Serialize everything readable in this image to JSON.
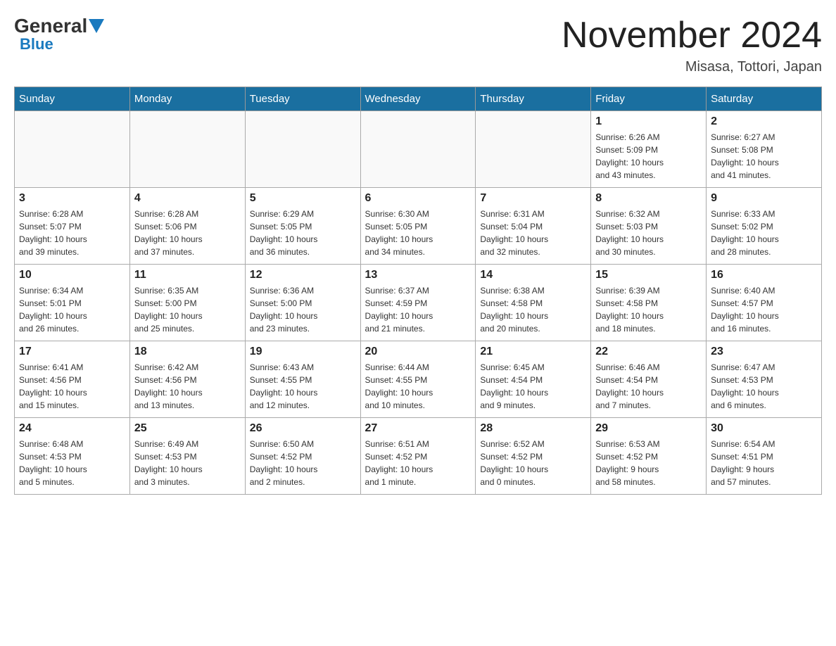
{
  "logo": {
    "general": "General",
    "blue": "Blue"
  },
  "title": "November 2024",
  "location": "Misasa, Tottori, Japan",
  "weekdays": [
    "Sunday",
    "Monday",
    "Tuesday",
    "Wednesday",
    "Thursday",
    "Friday",
    "Saturday"
  ],
  "weeks": [
    [
      {
        "day": "",
        "info": ""
      },
      {
        "day": "",
        "info": ""
      },
      {
        "day": "",
        "info": ""
      },
      {
        "day": "",
        "info": ""
      },
      {
        "day": "",
        "info": ""
      },
      {
        "day": "1",
        "info": "Sunrise: 6:26 AM\nSunset: 5:09 PM\nDaylight: 10 hours\nand 43 minutes."
      },
      {
        "day": "2",
        "info": "Sunrise: 6:27 AM\nSunset: 5:08 PM\nDaylight: 10 hours\nand 41 minutes."
      }
    ],
    [
      {
        "day": "3",
        "info": "Sunrise: 6:28 AM\nSunset: 5:07 PM\nDaylight: 10 hours\nand 39 minutes."
      },
      {
        "day": "4",
        "info": "Sunrise: 6:28 AM\nSunset: 5:06 PM\nDaylight: 10 hours\nand 37 minutes."
      },
      {
        "day": "5",
        "info": "Sunrise: 6:29 AM\nSunset: 5:05 PM\nDaylight: 10 hours\nand 36 minutes."
      },
      {
        "day": "6",
        "info": "Sunrise: 6:30 AM\nSunset: 5:05 PM\nDaylight: 10 hours\nand 34 minutes."
      },
      {
        "day": "7",
        "info": "Sunrise: 6:31 AM\nSunset: 5:04 PM\nDaylight: 10 hours\nand 32 minutes."
      },
      {
        "day": "8",
        "info": "Sunrise: 6:32 AM\nSunset: 5:03 PM\nDaylight: 10 hours\nand 30 minutes."
      },
      {
        "day": "9",
        "info": "Sunrise: 6:33 AM\nSunset: 5:02 PM\nDaylight: 10 hours\nand 28 minutes."
      }
    ],
    [
      {
        "day": "10",
        "info": "Sunrise: 6:34 AM\nSunset: 5:01 PM\nDaylight: 10 hours\nand 26 minutes."
      },
      {
        "day": "11",
        "info": "Sunrise: 6:35 AM\nSunset: 5:00 PM\nDaylight: 10 hours\nand 25 minutes."
      },
      {
        "day": "12",
        "info": "Sunrise: 6:36 AM\nSunset: 5:00 PM\nDaylight: 10 hours\nand 23 minutes."
      },
      {
        "day": "13",
        "info": "Sunrise: 6:37 AM\nSunset: 4:59 PM\nDaylight: 10 hours\nand 21 minutes."
      },
      {
        "day": "14",
        "info": "Sunrise: 6:38 AM\nSunset: 4:58 PM\nDaylight: 10 hours\nand 20 minutes."
      },
      {
        "day": "15",
        "info": "Sunrise: 6:39 AM\nSunset: 4:58 PM\nDaylight: 10 hours\nand 18 minutes."
      },
      {
        "day": "16",
        "info": "Sunrise: 6:40 AM\nSunset: 4:57 PM\nDaylight: 10 hours\nand 16 minutes."
      }
    ],
    [
      {
        "day": "17",
        "info": "Sunrise: 6:41 AM\nSunset: 4:56 PM\nDaylight: 10 hours\nand 15 minutes."
      },
      {
        "day": "18",
        "info": "Sunrise: 6:42 AM\nSunset: 4:56 PM\nDaylight: 10 hours\nand 13 minutes."
      },
      {
        "day": "19",
        "info": "Sunrise: 6:43 AM\nSunset: 4:55 PM\nDaylight: 10 hours\nand 12 minutes."
      },
      {
        "day": "20",
        "info": "Sunrise: 6:44 AM\nSunset: 4:55 PM\nDaylight: 10 hours\nand 10 minutes."
      },
      {
        "day": "21",
        "info": "Sunrise: 6:45 AM\nSunset: 4:54 PM\nDaylight: 10 hours\nand 9 minutes."
      },
      {
        "day": "22",
        "info": "Sunrise: 6:46 AM\nSunset: 4:54 PM\nDaylight: 10 hours\nand 7 minutes."
      },
      {
        "day": "23",
        "info": "Sunrise: 6:47 AM\nSunset: 4:53 PM\nDaylight: 10 hours\nand 6 minutes."
      }
    ],
    [
      {
        "day": "24",
        "info": "Sunrise: 6:48 AM\nSunset: 4:53 PM\nDaylight: 10 hours\nand 5 minutes."
      },
      {
        "day": "25",
        "info": "Sunrise: 6:49 AM\nSunset: 4:53 PM\nDaylight: 10 hours\nand 3 minutes."
      },
      {
        "day": "26",
        "info": "Sunrise: 6:50 AM\nSunset: 4:52 PM\nDaylight: 10 hours\nand 2 minutes."
      },
      {
        "day": "27",
        "info": "Sunrise: 6:51 AM\nSunset: 4:52 PM\nDaylight: 10 hours\nand 1 minute."
      },
      {
        "day": "28",
        "info": "Sunrise: 6:52 AM\nSunset: 4:52 PM\nDaylight: 10 hours\nand 0 minutes."
      },
      {
        "day": "29",
        "info": "Sunrise: 6:53 AM\nSunset: 4:52 PM\nDaylight: 9 hours\nand 58 minutes."
      },
      {
        "day": "30",
        "info": "Sunrise: 6:54 AM\nSunset: 4:51 PM\nDaylight: 9 hours\nand 57 minutes."
      }
    ]
  ]
}
